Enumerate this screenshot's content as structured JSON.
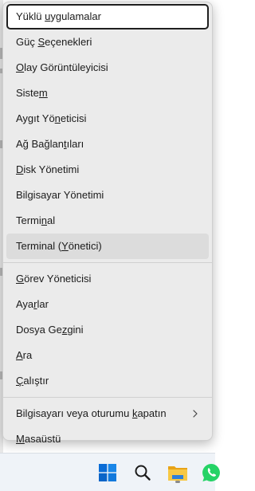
{
  "menu": {
    "groups": [
      [
        {
          "pre": "Yüklü ",
          "u": "u",
          "post": "ygulamalar",
          "state": "focused"
        },
        {
          "pre": "Güç ",
          "u": "S",
          "post": "eçenekleri"
        },
        {
          "pre": "",
          "u": "O",
          "post": "lay Görüntüleyicisi"
        },
        {
          "pre": "Siste",
          "u": "m",
          "post": ""
        },
        {
          "pre": "Aygıt Yö",
          "u": "n",
          "post": "eticisi"
        },
        {
          "pre": "Ağ Bağlan",
          "u": "t",
          "post": "ıları"
        },
        {
          "pre": "",
          "u": "D",
          "post": "isk Yönetimi"
        },
        {
          "pre": "Bilgisayar Yönetimi",
          "u": "",
          "post": ""
        },
        {
          "pre": "Termi",
          "u": "n",
          "post": "al"
        },
        {
          "pre": "Terminal (",
          "u": "Y",
          "post": "önetici)",
          "state": "hover"
        }
      ],
      [
        {
          "pre": "",
          "u": "G",
          "post": "örev Yöneticisi"
        },
        {
          "pre": "Aya",
          "u": "r",
          "post": "lar"
        },
        {
          "pre": "Dosya Ge",
          "u": "z",
          "post": "gini"
        },
        {
          "pre": "",
          "u": "A",
          "post": "ra"
        },
        {
          "pre": "",
          "u": "Ç",
          "post": "alıştır"
        }
      ],
      [
        {
          "pre": "Bilgisayarı veya oturumu ",
          "u": "k",
          "post": "apatın",
          "submenu": true
        },
        {
          "pre": "",
          "u": "M",
          "post": "asaüstü"
        }
      ]
    ]
  },
  "taskbar": {
    "icons": [
      "windows-start-icon",
      "search-icon",
      "file-explorer-icon",
      "whatsapp-icon"
    ]
  },
  "colors": {
    "menu_bg": "#ebebeb",
    "focus_outline": "#1f1f1f",
    "hover_bg": "#dcdcdc",
    "windows_blue": "#0a6cd6",
    "folder_yellow": "#f3b62b",
    "whatsapp_green": "#25d366"
  }
}
